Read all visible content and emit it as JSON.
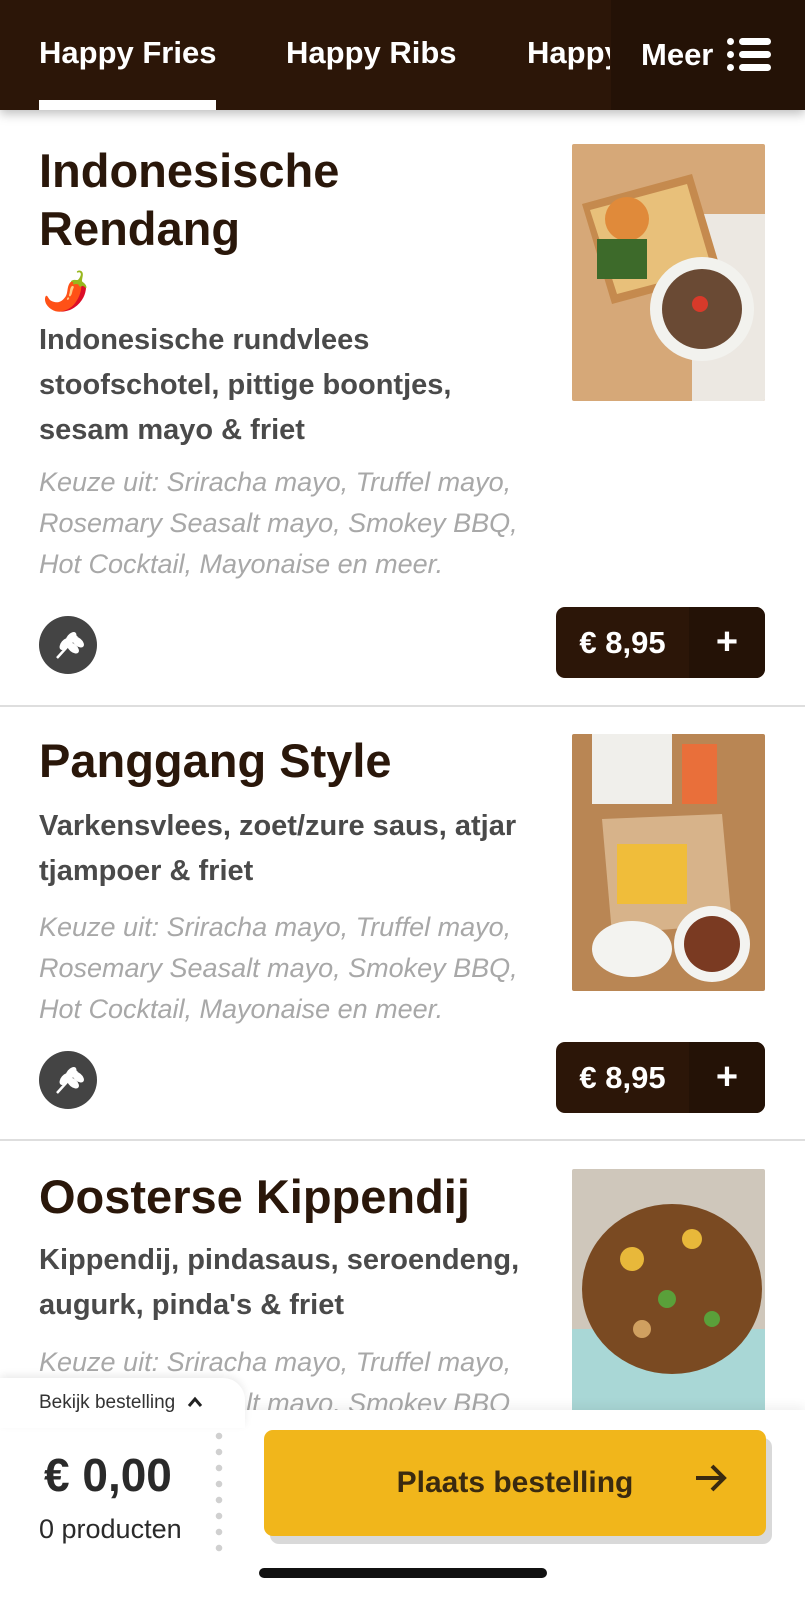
{
  "nav": {
    "tabs": [
      "Happy Fries",
      "Happy Ribs",
      "Happy"
    ],
    "active_tab": 0,
    "more_label": "Meer",
    "more_icon": "list-icon"
  },
  "items": [
    {
      "title": "Indonesische Rendang",
      "spicy_icon": "chili-pepper-icon",
      "description": "Indonesische rundvlees stoofschotel, pittige boontjes, sesam mayo & friet",
      "choice": "Keuze uit: Sriracha mayo, Truffel mayo, Rosemary Seasalt mayo, Smokey BBQ, Hot Cocktail, Mayonaise en meer.",
      "allergen_icon": "gluten-wheat-icon",
      "price": "€ 8,95",
      "add_label": "+"
    },
    {
      "title": "Panggang Style",
      "description": "Varkensvlees, zoet/zure saus, atjar tjampoer & friet",
      "choice": "Keuze uit: Sriracha mayo, Truffel mayo, Rosemary Seasalt mayo, Smokey BBQ, Hot Cocktail, Mayonaise en meer.",
      "allergen_icon": "gluten-wheat-icon",
      "price": "€ 8,95",
      "add_label": "+"
    },
    {
      "title": "Oosterse Kippendij",
      "description": "Kippendij, pindasaus, seroendeng, augurk, pinda's & friet",
      "choice": "Keuze uit: Sriracha mayo, Truffel mayo, Rosemary Seasalt mayo, Smokey BBQ"
    }
  ],
  "cart": {
    "peek_label": "Bekijk bestelling",
    "total": "€ 0,00",
    "count": "0 producten",
    "order_label": "Plaats bestelling",
    "accent_color": "#f1b61b"
  },
  "colors": {
    "brand_dark": "#2c1608"
  }
}
